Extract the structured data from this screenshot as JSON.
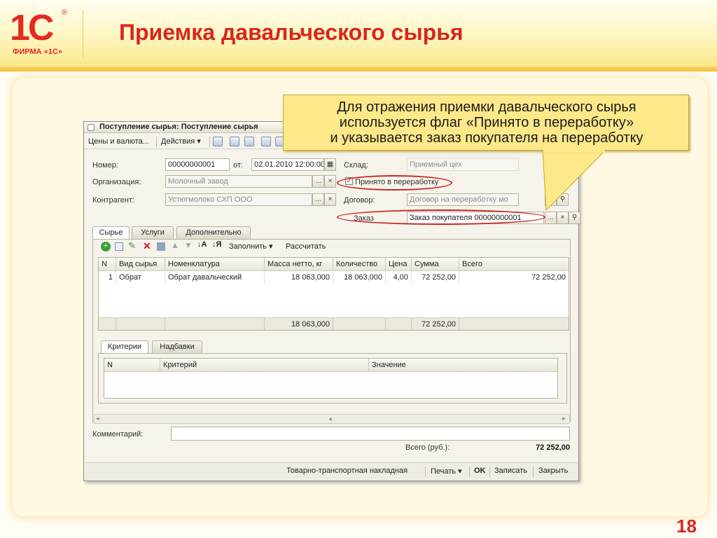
{
  "logo": {
    "mark": "1С",
    "reg": "®",
    "firm": "ФИРМА «1С»"
  },
  "slide": {
    "title": "Приемка давальческого сырья",
    "page_number": "18"
  },
  "callout": {
    "text": "Для отражения приемки давальческого сырья\nиспользуется флаг «Принято в переработку»\nи указывается заказ покупателя на переработку"
  },
  "colors": {
    "title_red": "#d9261c",
    "callout_bg": "#fde98a",
    "ellipse_red": "#cc2222"
  },
  "window": {
    "title": "Поступление сырья: Поступление сырья",
    "toolbar": {
      "prices": "Цены и валюта...",
      "actions": "Действия ▾"
    },
    "form": {
      "number_label": "Номер:",
      "number_value": "00000000001",
      "from_label": "от:",
      "date_value": "02.01.2010 12:00:00",
      "warehouse_label": "Склад:",
      "warehouse_value": "Приемный цех",
      "organization_label": "Организация:",
      "organization_value": "Молочный завод",
      "accepted_flag_label": "Принято в переработку",
      "accepted_flag_checked": true,
      "contractor_label": "Контрагент:",
      "contractor_value": "Устюгмолоко СХП ООО",
      "contract_label": "Договор:",
      "contract_value": "Договор на переработку мо",
      "order_label": "Заказ",
      "order_value": "Заказ покупателя 00000000001"
    },
    "tabs": [
      "Сырье",
      "Услуги",
      "Дополнительно"
    ],
    "grid_toolbar": {
      "fill": "Заполнить ▾",
      "calculate": "Рассчитать"
    },
    "materials_table": {
      "columns": [
        "N",
        "Вид сырья",
        "Номенклатура",
        "Масса нетто, кг",
        "Количество",
        "Цена",
        "Сумма",
        "Всего"
      ],
      "rows": [
        [
          "1",
          "Обрат",
          "Обрат давальческий",
          "18 063,000",
          "18 063,000",
          "4,00",
          "72 252,00",
          "72 252,00"
        ]
      ],
      "totals": {
        "mass": "18 063,000",
        "sum": "72 252,00"
      }
    },
    "bottom_tabs": [
      "Критерии",
      "Надбавки"
    ],
    "criteria_table": {
      "columns": [
        "N",
        "Критерий",
        "Значение"
      ]
    },
    "comment_label": "Комментарий:",
    "total_label": "Всего (руб.):",
    "total_value": "72 252,00",
    "footer": {
      "waybill": "Товарно-транспортная накладная",
      "print": "Печать ▾",
      "ok": "OK",
      "save": "Записать",
      "close": "Закрыть"
    }
  }
}
